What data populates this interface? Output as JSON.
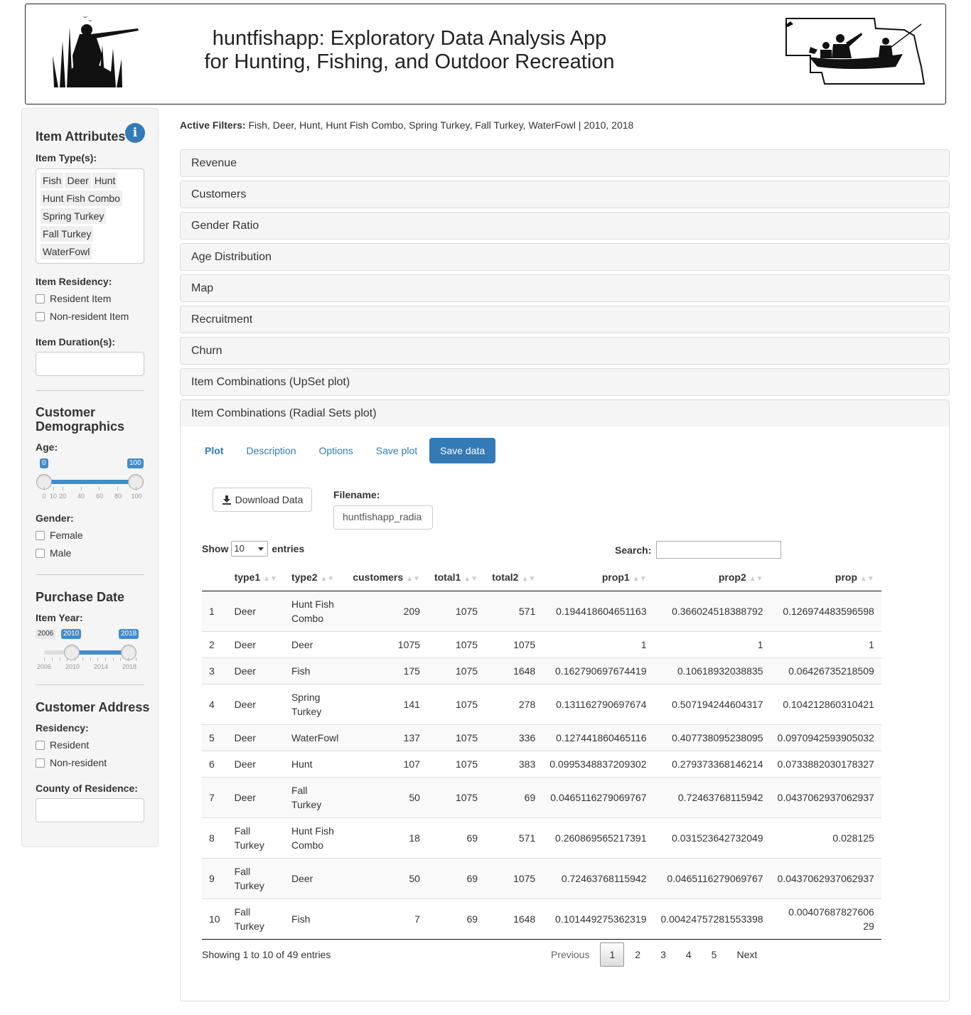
{
  "header": {
    "title_line1": "huntfishapp: Exploratory Data Analysis App",
    "title_line2": "for Hunting, Fishing, and Outdoor Recreation"
  },
  "sidebar": {
    "item_attributes_heading": "Item Attributes",
    "item_types_label": "Item Type(s):",
    "item_types": [
      "Fish",
      "Deer",
      "Hunt",
      "Hunt Fish Combo",
      "Spring Turkey",
      "Fall Turkey",
      "WaterFowl"
    ],
    "item_residency_label": "Item Residency:",
    "resident_item": "Resident Item",
    "nonresident_item": "Non-resident Item",
    "item_duration_label": "Item Duration(s):",
    "customer_demographics_heading": "Customer Demographics",
    "age_label": "Age:",
    "age_slider": {
      "min": 0,
      "max": 100,
      "from": 0,
      "to": 100,
      "from_label": "0",
      "to_label": "100",
      "ticks": [
        "0",
        "10",
        "20",
        "40",
        "60",
        "80",
        "100"
      ]
    },
    "gender_label": "Gender:",
    "female": "Female",
    "male": "Male",
    "purchase_date_heading": "Purchase Date",
    "item_year_label": "Item Year:",
    "year_slider": {
      "min": 2006,
      "max": 2018,
      "from": 2010,
      "to": 2018,
      "min_label": "2006",
      "from_label": "2010",
      "to_label": "2018",
      "ticks": [
        "2006",
        "2010",
        "2014",
        "2018"
      ]
    },
    "customer_address_heading": "Customer Address",
    "residency_label": "Residency:",
    "resident": "Resident",
    "nonresident": "Non-resident",
    "county_label": "County of Residence:"
  },
  "main": {
    "active_filters_label": "Active Filters:",
    "active_filters_value": "Fish, Deer, Hunt, Hunt Fish Combo, Spring Turkey, Fall Turkey, WaterFowl | 2010, 2018",
    "panels": [
      "Revenue",
      "Customers",
      "Gender Ratio",
      "Age Distribution",
      "Map",
      "Recruitment",
      "Churn",
      "Item Combinations (UpSet plot)",
      "Item Combinations (Radial Sets plot)"
    ],
    "tabs": [
      "Plot",
      "Description",
      "Options",
      "Save plot",
      "Save data"
    ],
    "download_button": "Download Data",
    "filename_label": "Filename:",
    "filename_value": "huntfishapp_radia",
    "show_label": "Show",
    "entries_value": "10",
    "entries_label": "entries",
    "search_label": "Search:",
    "columns": [
      "",
      "type1",
      "type2",
      "customers",
      "total1",
      "total2",
      "prop1",
      "prop2",
      "prop"
    ],
    "rows": [
      [
        "1",
        "Deer",
        "Hunt Fish Combo",
        "209",
        "1075",
        "571",
        "0.194418604651163",
        "0.366024518388792",
        "0.126974483596598"
      ],
      [
        "2",
        "Deer",
        "Deer",
        "1075",
        "1075",
        "1075",
        "1",
        "1",
        "1"
      ],
      [
        "3",
        "Deer",
        "Fish",
        "175",
        "1075",
        "1648",
        "0.162790697674419",
        "0.10618932038835",
        "0.06426735218509"
      ],
      [
        "4",
        "Deer",
        "Spring Turkey",
        "141",
        "1075",
        "278",
        "0.131162790697674",
        "0.507194244604317",
        "0.104212860310421"
      ],
      [
        "5",
        "Deer",
        "WaterFowl",
        "137",
        "1075",
        "336",
        "0.127441860465116",
        "0.407738095238095",
        "0.0970942593905032"
      ],
      [
        "6",
        "Deer",
        "Hunt",
        "107",
        "1075",
        "383",
        "0.0995348837209302",
        "0.279373368146214",
        "0.0733882030178327"
      ],
      [
        "7",
        "Deer",
        "Fall Turkey",
        "50",
        "1075",
        "69",
        "0.0465116279069767",
        "0.72463768115942",
        "0.0437062937062937"
      ],
      [
        "8",
        "Fall Turkey",
        "Hunt Fish Combo",
        "18",
        "69",
        "571",
        "0.260869565217391",
        "0.031523642732049",
        "0.028125"
      ],
      [
        "9",
        "Fall Turkey",
        "Deer",
        "50",
        "69",
        "1075",
        "0.72463768115942",
        "0.0465116279069767",
        "0.0437062937062937"
      ],
      [
        "10",
        "Fall Turkey",
        "Fish",
        "7",
        "69",
        "1648",
        "0.101449275362319",
        "0.00424757281553398",
        "0.00407687827606 29"
      ]
    ],
    "info": "Showing 1 to 10 of 49 entries",
    "pager": [
      "Previous",
      "1",
      "2",
      "3",
      "4",
      "5",
      "Next"
    ]
  },
  "colors": {
    "accent": "#337ab7",
    "slider": "#428bca"
  }
}
